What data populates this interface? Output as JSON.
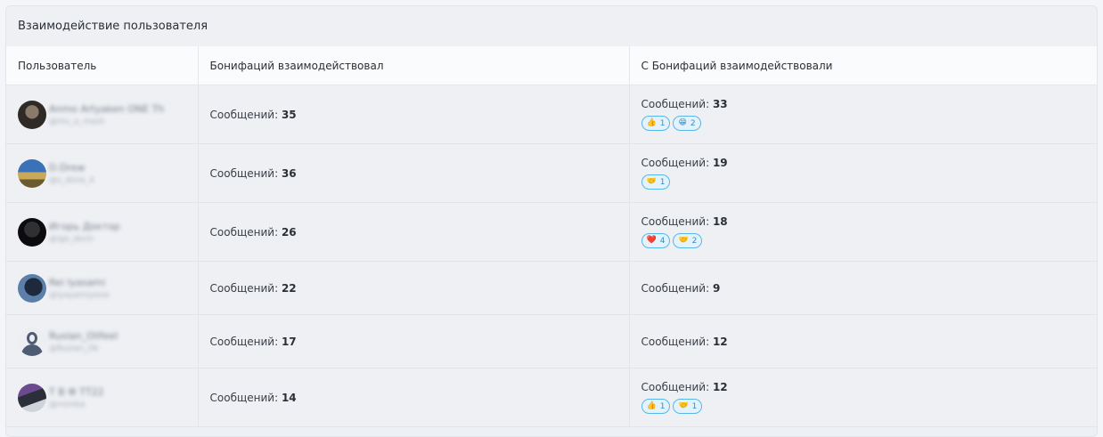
{
  "panel": {
    "title": "Взаимодействие пользователя"
  },
  "table": {
    "columns": [
      "Пользователь",
      "Бонифаций взаимодействовал",
      "С Бонифаций взаимодействовали"
    ],
    "message_label": "Сообщений: ",
    "rows": [
      {
        "user": {
          "name": "Anmo Artyaken ONE Th",
          "handle": "@mu_a_mash"
        },
        "sent": "35",
        "received": "33",
        "reactions": [
          {
            "emoji": "👍",
            "count": "1"
          },
          {
            "emoji": "😁",
            "count": "2"
          }
        ]
      },
      {
        "user": {
          "name": "D.Drew",
          "handle": "@s_done_4"
        },
        "sent": "36",
        "received": "19",
        "reactions": [
          {
            "emoji": "🤝",
            "count": "1"
          }
        ]
      },
      {
        "user": {
          "name": "Игорь Доктор",
          "handle": "@igo_doctr"
        },
        "sent": "26",
        "received": "18",
        "reactions": [
          {
            "emoji": "❤️",
            "count": "4"
          },
          {
            "emoji": "🤝",
            "count": "2"
          }
        ]
      },
      {
        "user": {
          "name": "Rei Iyasami",
          "handle": "@iyayamiyosie"
        },
        "sent": "22",
        "received": "9",
        "reactions": []
      },
      {
        "user": {
          "name": "Ruslan_Olifeel",
          "handle": "@Ruslan_Ok"
        },
        "sent": "17",
        "received": "12",
        "reactions": []
      },
      {
        "user": {
          "name": "Т В Ф ТТ22",
          "handle": "@mimba"
        },
        "sent": "14",
        "received": "12",
        "reactions": [
          {
            "emoji": "👍",
            "count": "1"
          },
          {
            "emoji": "🤝",
            "count": "1"
          }
        ]
      }
    ]
  }
}
